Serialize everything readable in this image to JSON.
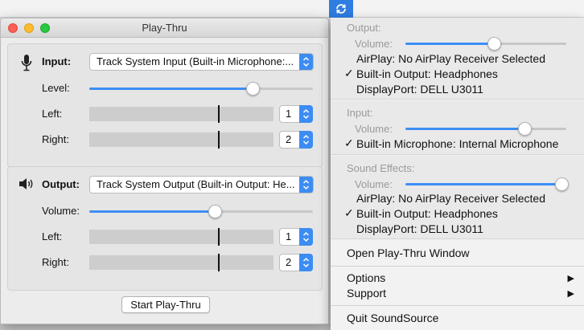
{
  "window": {
    "title": "Play-Thru",
    "input": {
      "label": "Input:",
      "device": "Track System Input (Built-in Microphone:...",
      "level_label": "Level:",
      "level": 0.73,
      "left_label": "Left:",
      "left_channel": "1",
      "left_peak": 0.7,
      "right_label": "Right:",
      "right_channel": "2",
      "right_peak": 0.7
    },
    "output": {
      "label": "Output:",
      "device": "Track System Output (Built-in Output: He...",
      "volume_label": "Volume:",
      "volume": 0.56,
      "left_label": "Left:",
      "left_channel": "1",
      "left_peak": 0.7,
      "right_label": "Right:",
      "right_channel": "2",
      "right_peak": 0.7
    },
    "start_button": "Start Play-Thru"
  },
  "menu": {
    "output": {
      "heading": "Output:",
      "volume_label": "Volume:",
      "volume": 0.55,
      "devices": [
        {
          "label": "AirPlay: No AirPlay Receiver Selected",
          "checked": false
        },
        {
          "label": "Built-in Output: Headphones",
          "checked": true
        },
        {
          "label": "DisplayPort: DELL U3011",
          "checked": false
        }
      ]
    },
    "input": {
      "heading": "Input:",
      "volume_label": "Volume:",
      "volume": 0.74,
      "devices": [
        {
          "label": "Built-in Microphone: Internal Microphone",
          "checked": true
        }
      ]
    },
    "sound_effects": {
      "heading": "Sound Effects:",
      "volume_label": "Volume:",
      "volume": 0.97,
      "devices": [
        {
          "label": "AirPlay: No AirPlay Receiver Selected",
          "checked": false
        },
        {
          "label": "Built-in Output: Headphones",
          "checked": true
        },
        {
          "label": "DisplayPort: DELL U3011",
          "checked": false
        }
      ]
    },
    "open_window": "Open Play-Thru Window",
    "options": "Options",
    "support": "Support",
    "quit": "Quit SoundSource",
    "check_glyph": "✓",
    "submenu_glyph": "▶"
  },
  "colors": {
    "accent": "#3d8ef5",
    "menubar_icon_bg": "#2f7de1"
  }
}
